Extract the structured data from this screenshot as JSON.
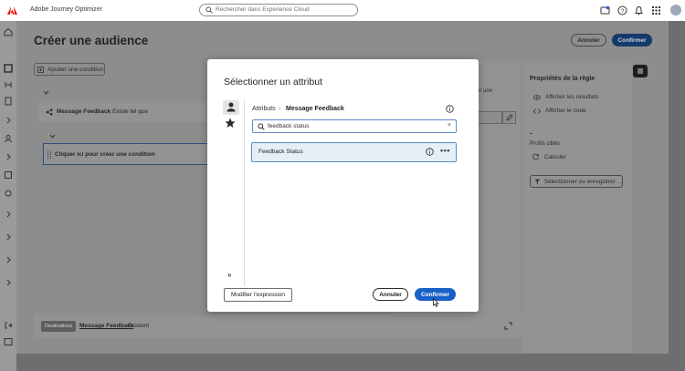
{
  "topbar": {
    "app_title": "Adobe Journey Optimizer",
    "search_placeholder": "Rechercher dans Experience Cloud",
    "icons": [
      "notification-icon",
      "help-icon",
      "bell-icon",
      "apps-grid-icon",
      "avatar"
    ]
  },
  "page": {
    "title": "Créer une audience",
    "cancel_label": "Annuler",
    "confirm_label": "Confirmer",
    "add_condition_label": "Ajouter une condition",
    "condition_row": {
      "name": "Message Feedback",
      "operator": "Existe tel que"
    },
    "drop_zone_label": "Cliquer ici pour créer une condition",
    "mid_text": "er une"
  },
  "rule_properties": {
    "title": "Propriétés de la règle",
    "show_results": "Afficher les résultats",
    "show_code": "Afficher le code",
    "dash": "-",
    "target_profiles": "Profils ciblés",
    "calculate": "Calculer",
    "select_or_save": "Sélectionner ou enregistrer ..."
  },
  "destinations": {
    "badge": "Destinations",
    "name": "Message Feedback",
    "status": "Existent"
  },
  "modal": {
    "title": "Sélectionner un attribut",
    "breadcrumb_root": "Attributs",
    "breadcrumb_sep": "›",
    "breadcrumb_current": "Message Feedback",
    "search_value": "feedback status",
    "clear": "×",
    "result_label": "Feedback Status",
    "more": "•••",
    "expand": "»",
    "edit_expression": "Modifier l'expression",
    "cancel_label": "Annuler",
    "confirm_label": "Confirmer"
  },
  "colors": {
    "accent_blue": "#1a60c9",
    "adobe_red": "#eb1000",
    "result_bg": "#e6eef8"
  }
}
